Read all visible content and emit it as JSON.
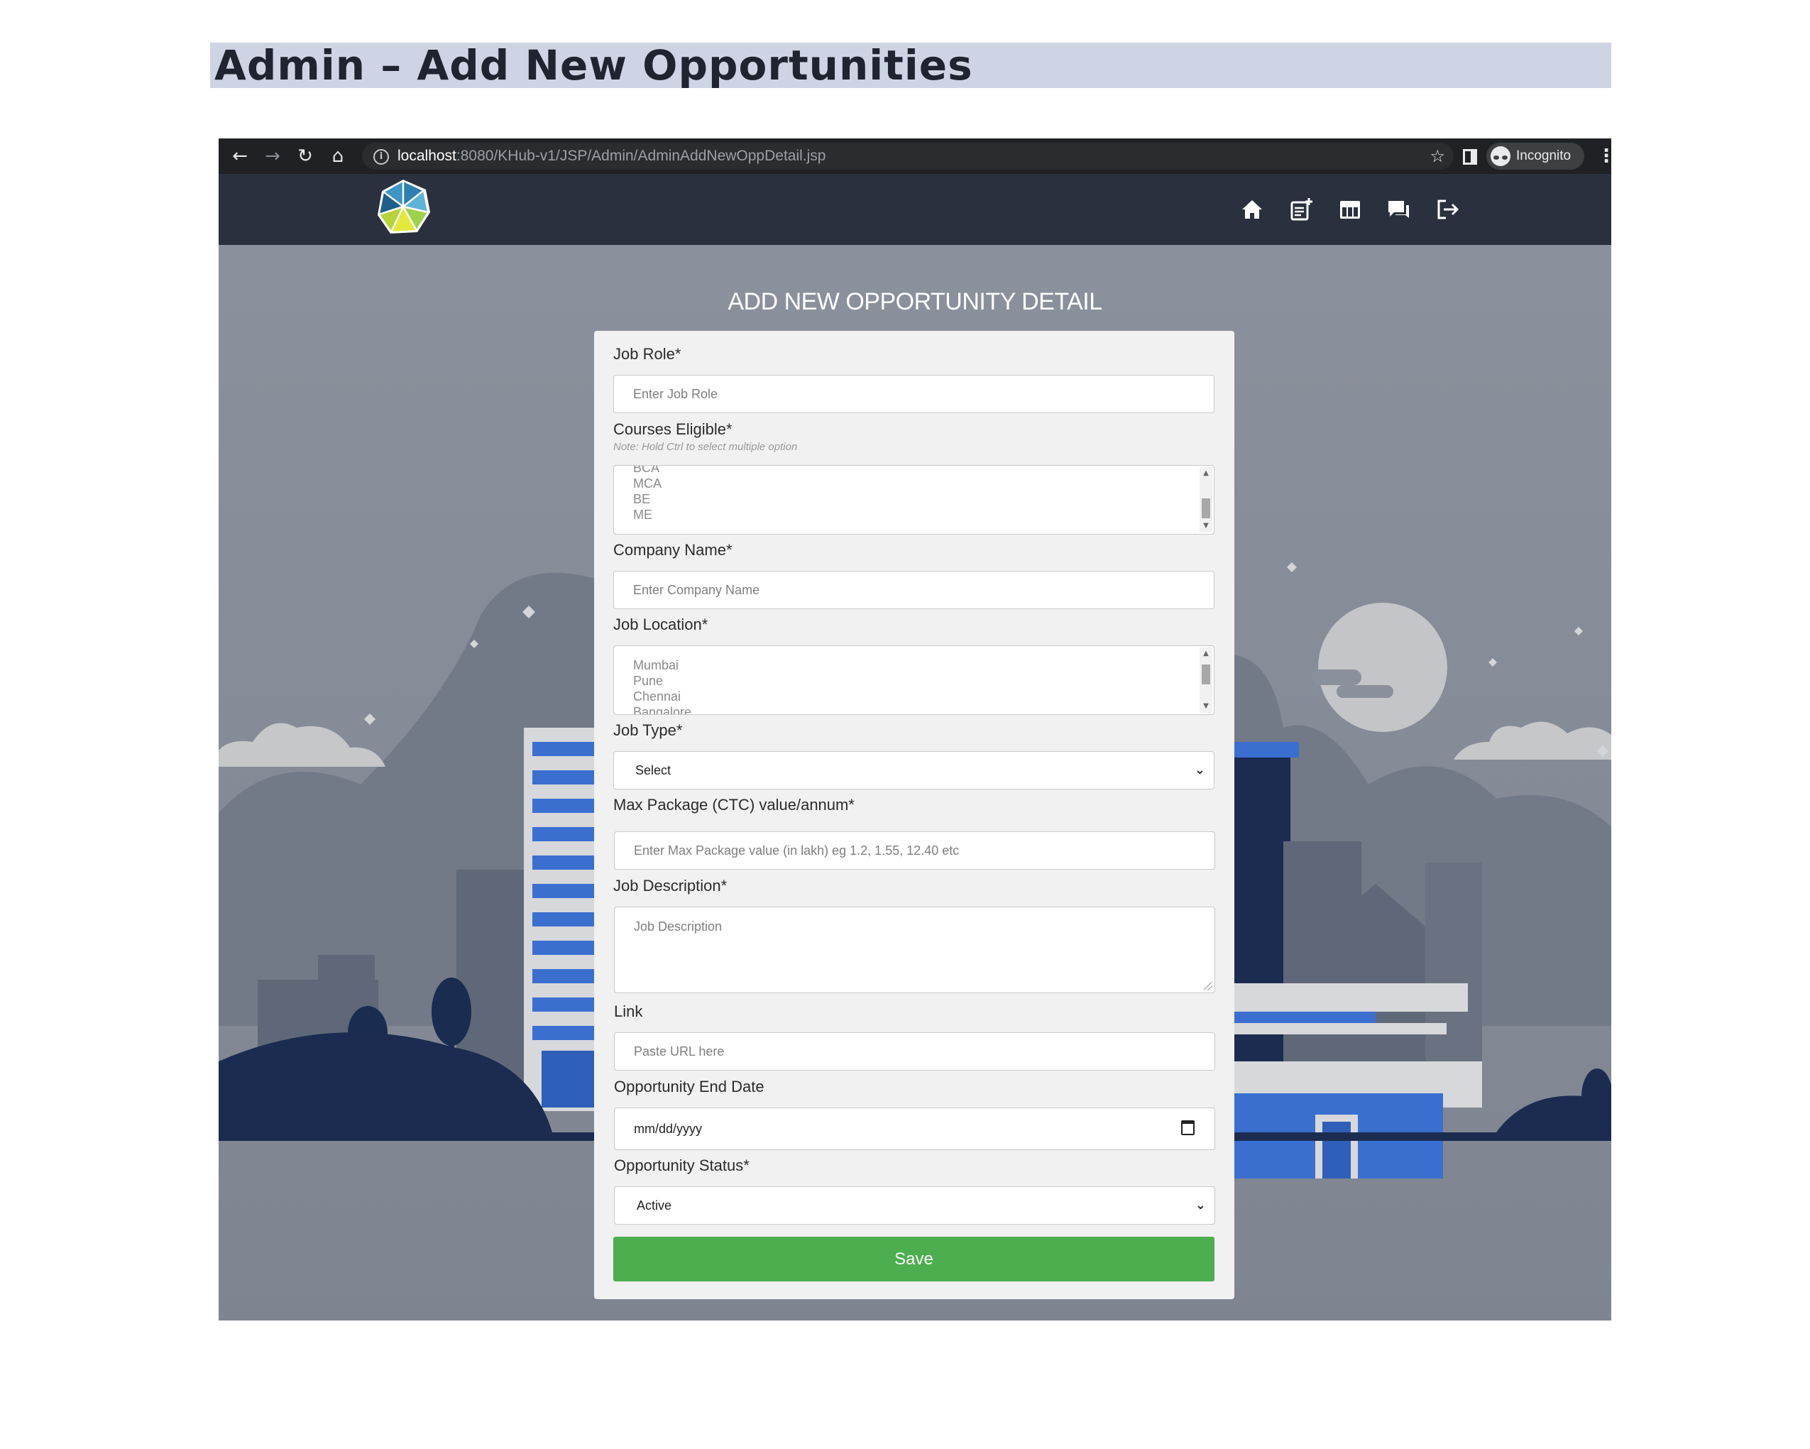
{
  "document": {
    "title": "Admin – Add New Opportunities"
  },
  "browser": {
    "url_host": "localhost",
    "url_path": ":8080/KHub-v1/JSP/Admin/AdminAddNewOppDetail.jsp",
    "profile_label": "Incognito",
    "icons": [
      "back-icon",
      "forward-icon",
      "reload-icon",
      "home-icon",
      "info-icon",
      "bookmark-star-icon",
      "side-panel-icon",
      "incognito-icon",
      "kebab-menu-icon"
    ]
  },
  "header": {
    "logo": "knowledge-hub-logo",
    "nav_icons": [
      "home-icon",
      "add-post-icon",
      "table-icon",
      "chat-icon",
      "logout-icon"
    ]
  },
  "page": {
    "heading": "ADD NEW OPPORTUNITY DETAIL"
  },
  "form": {
    "job_role": {
      "label": "Job Role*",
      "placeholder": "Enter Job Role"
    },
    "courses": {
      "label": "Courses Eligible*",
      "note": "Note: Hold Ctrl to select multiple option",
      "options": [
        "BCA",
        "MCA",
        "BE",
        "ME"
      ]
    },
    "company": {
      "label": "Company Name*",
      "placeholder": "Enter Company Name"
    },
    "location": {
      "label": "Job Location*",
      "options": [
        "Mumbai",
        "Pune",
        "Chennai",
        "Bangalore"
      ]
    },
    "job_type": {
      "label": "Job Type*",
      "value": "Select"
    },
    "package": {
      "label": "Max Package (CTC) value/annum*",
      "placeholder": "Enter Max Package value (in lakh) eg 1.2, 1.55, 12.40 etc"
    },
    "description": {
      "label": "Job Description*",
      "placeholder": "Job Description"
    },
    "link": {
      "label": "Link",
      "placeholder": "Paste URL here"
    },
    "end_date": {
      "label": "Opportunity End Date",
      "value": "mm/dd/yyyy"
    },
    "status": {
      "label": "Opportunity Status*",
      "value": "Active"
    },
    "save_label": "Save"
  },
  "colors": {
    "header_bg": "#2a303d",
    "save_button": "#4cae4f",
    "building_accent": "#3a6fd0",
    "title_highlight": "#cfd4e4"
  }
}
